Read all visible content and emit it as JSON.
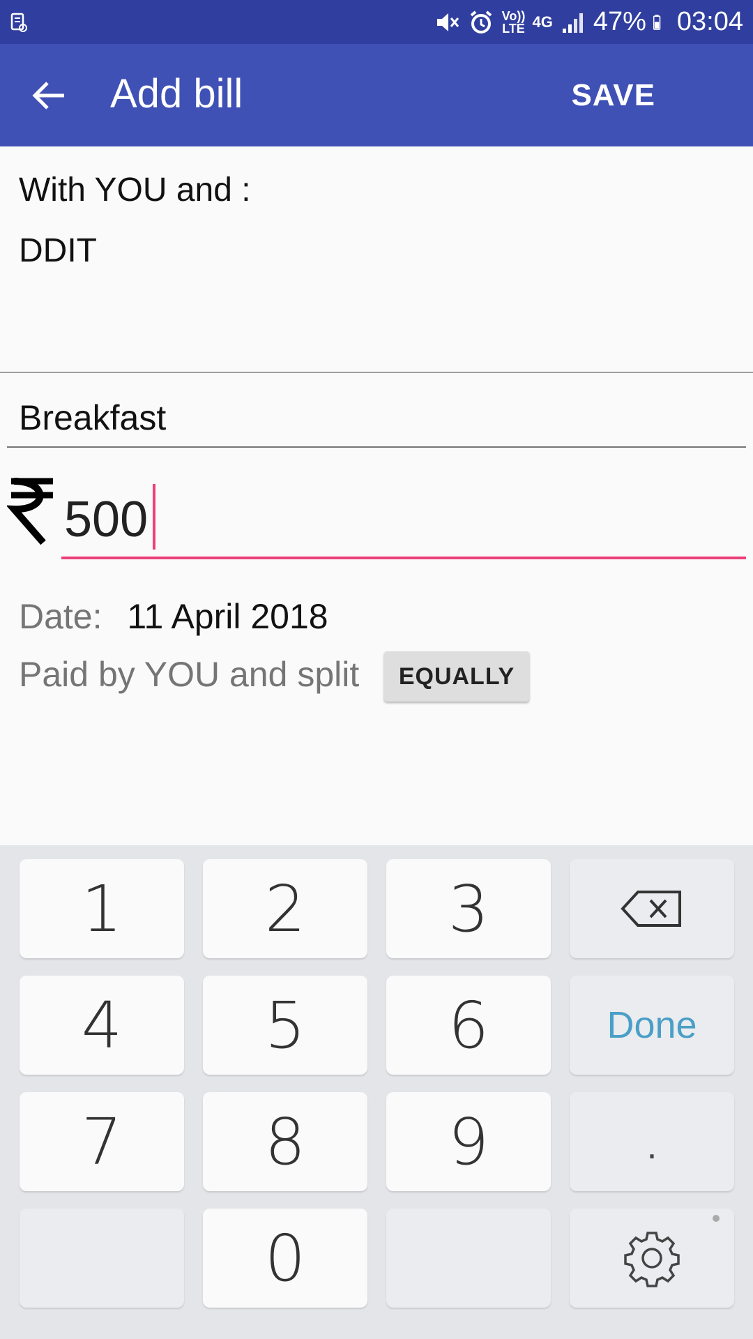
{
  "status_bar": {
    "volte_label": "Vo)) LTE",
    "network": "4G",
    "battery": "47%",
    "time": "03:04"
  },
  "app_bar": {
    "title": "Add bill",
    "save_label": "SAVE"
  },
  "participants": {
    "label": "With YOU and :",
    "names": "DDIT"
  },
  "description": {
    "value": "Breakfast"
  },
  "amount": {
    "currency_symbol": "₹",
    "value": "500"
  },
  "date": {
    "label": "Date:",
    "value": "11 April 2018"
  },
  "split": {
    "text": "Paid by YOU and split",
    "button_label": "EQUALLY"
  },
  "keyboard": {
    "keys": {
      "k1": "1",
      "k2": "2",
      "k3": "3",
      "k4": "4",
      "k5": "5",
      "k6": "6",
      "k7": "7",
      "k8": "8",
      "k9": "9",
      "k0": "0",
      "dot": ".",
      "done": "Done"
    },
    "icons": {
      "backspace": "backspace-icon",
      "settings": "gear-icon"
    }
  },
  "colors": {
    "status_bar": "#303f9f",
    "app_bar": "#3f51b5",
    "accent": "#ec407a",
    "done_text": "#4a9fc7"
  }
}
